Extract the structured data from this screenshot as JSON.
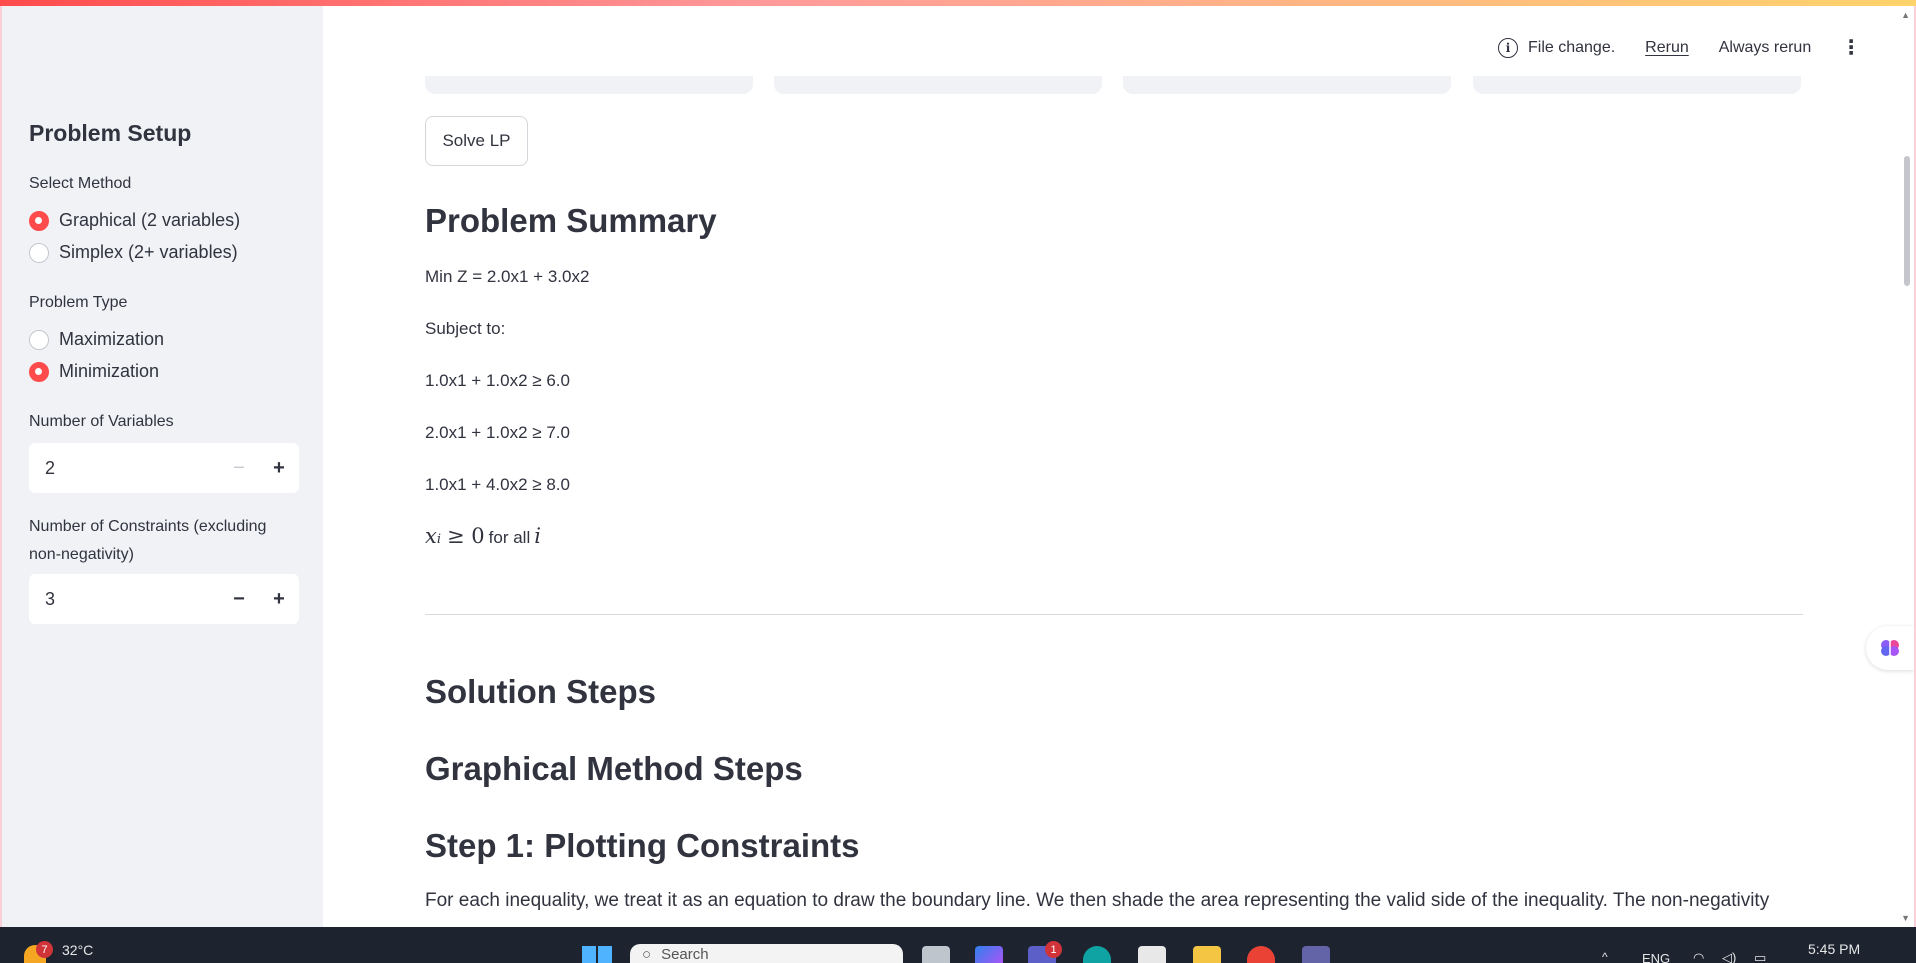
{
  "sidebar": {
    "title": "Problem Setup",
    "method_label": "Select Method",
    "methods": [
      "Graphical (2 variables)",
      "Simplex (2+ variables)"
    ],
    "selected_method": "Graphical (2 variables)",
    "type_label": "Problem Type",
    "types": [
      "Maximization",
      "Minimization"
    ],
    "selected_type": "Minimization",
    "variables_label": "Number of Variables",
    "variables_value": "2",
    "constraints_label_line1": "Number of Constraints (excluding",
    "constraints_label_line2": "non-negativity)",
    "constraints_value": "3"
  },
  "header": {
    "status": "File change.",
    "rerun": "Rerun",
    "always_rerun": "Always rerun"
  },
  "main": {
    "solve_button": "Solve LP",
    "summary_heading": "Problem Summary",
    "objective": "Min Z = 2.0x1 + 3.0x2",
    "subject_to": "Subject to:",
    "constraints": [
      "1.0x1 + 1.0x2 ≥ 6.0",
      "2.0x1 + 1.0x2 ≥ 7.0",
      "1.0x1 + 4.0x2 ≥ 8.0"
    ],
    "nonneg_math": "x",
    "nonneg_sub": "i",
    "nonneg_rel": "≥ 0",
    "nonneg_text": "for all",
    "nonneg_var": "i",
    "solution_heading": "Solution Steps",
    "graphical_heading": "Graphical Method Steps",
    "step1_heading": "Step 1: Plotting Constraints",
    "step1_text": "For each inequality, we treat it as an equation to draw the boundary line. We then shade the area representing the valid side of the inequality. The non-negativity"
  },
  "taskbar": {
    "weather_badge": "7",
    "temperature": "32°C",
    "search_placeholder": "Search",
    "teams_badge": "1",
    "language": "ENG",
    "time": "5:45 PM"
  },
  "colors": {
    "accent": "#ff4b4b",
    "sidebar_bg": "#f0f2f6",
    "taskbar_bg": "#1d2430"
  }
}
